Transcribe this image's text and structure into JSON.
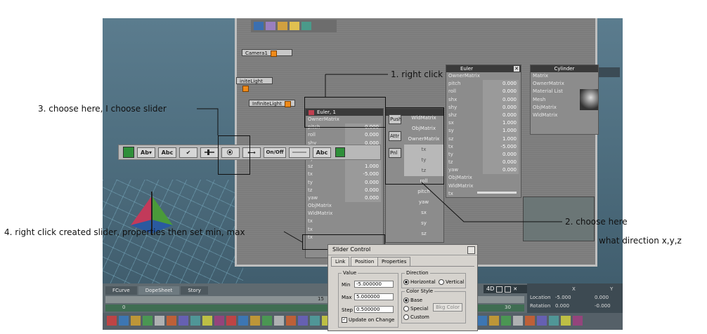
{
  "viewport": {
    "camera_chip": "Camera1",
    "light_chip_1": "initeLight",
    "light_chip_2": "InfiniteLight"
  },
  "euler_node_main": {
    "title": "Euler",
    "rows": [
      {
        "label": "OwnerMatrix",
        "value": ""
      },
      {
        "label": "pitch",
        "value": "0.000"
      },
      {
        "label": "roll",
        "value": "0.000"
      },
      {
        "label": "shx",
        "value": "0.000"
      },
      {
        "label": "shy",
        "value": "0.000"
      },
      {
        "label": "shz",
        "value": "0.000"
      },
      {
        "label": "sx",
        "value": "1.000"
      },
      {
        "label": "sy",
        "value": "1.000"
      },
      {
        "label": "sz",
        "value": "1.000"
      },
      {
        "label": "tx",
        "value": "-5.000"
      },
      {
        "label": "ty",
        "value": "0.000"
      },
      {
        "label": "tz",
        "value": "0.000"
      },
      {
        "label": "yaw",
        "value": "0.000"
      },
      {
        "label": "ObjMatrix",
        "value": ""
      },
      {
        "label": "WldMatrix",
        "value": ""
      },
      {
        "label": "tx",
        "value": ""
      }
    ]
  },
  "cylinder_node": {
    "title": "Cylinder",
    "rows": [
      "Matrix",
      "OwnerMatrix",
      "Material List",
      "Mesh",
      "ObjMatrix",
      "WldMatrix"
    ]
  },
  "euler_node_1": {
    "title": "Euler, 1",
    "rows": [
      {
        "label": "OwnerMatrix",
        "value": ""
      },
      {
        "label": "pitch",
        "value": "0.000"
      },
      {
        "label": "roll",
        "value": "0.000"
      },
      {
        "label": "shy",
        "value": "0.000"
      },
      {
        "label": "sx",
        "value": "1.000"
      },
      {
        "label": "sy",
        "value": "1.000"
      },
      {
        "label": "sz",
        "value": "1.000"
      },
      {
        "label": "tx",
        "value": "-5.000"
      },
      {
        "label": "ty",
        "value": "0.000"
      },
      {
        "label": "tz",
        "value": "0.000"
      },
      {
        "label": "yaw",
        "value": "0.000"
      },
      {
        "label": "ObjMatrix",
        "value": ""
      },
      {
        "label": "WldMatrix",
        "value": ""
      },
      {
        "label": "tx",
        "value": ""
      },
      {
        "label": "tx",
        "value": ""
      },
      {
        "label": "tx",
        "value": ""
      }
    ]
  },
  "matrix_node": {
    "buttons": [
      "Push",
      "Attr",
      "Pnl"
    ],
    "rows": [
      "WldMatrix",
      "ObjMatrix",
      "OwnerMatrix",
      "tx",
      "ty",
      "tz",
      "roll",
      "pitch",
      "yaw",
      "sx",
      "sy",
      "sz"
    ]
  },
  "toolbar": {
    "items": [
      "",
      "Ab▾",
      "Abc",
      "✔",
      "",
      "",
      "⟷",
      "On/Off",
      "",
      "Abc"
    ]
  },
  "annotations": {
    "step1": "1. right click",
    "step2": "2. choose here",
    "step3": "3. choose here, I choose slider",
    "step4": "4. right click created slider, properties then set min, max",
    "note": "what direction x,y,z"
  },
  "dialog": {
    "title": "Slider Control",
    "tabs": [
      "Link",
      "Position",
      "Properties"
    ],
    "value_group": "Value",
    "min_label": "Min",
    "min_value": "-5.000000",
    "max_label": "Max",
    "max_value": "5.000000",
    "step_label": "Step",
    "step_value": "0.500000",
    "update_label": "Update on Change",
    "direction_group": "Direction",
    "horizontal": "Horizontal",
    "vertical": "Vertical",
    "color_group": "Color Style",
    "base": "Base",
    "special": "Special",
    "custom": "Custom",
    "bkg_color": "Bkg Color"
  },
  "timeline": {
    "tabs": [
      "FCurve",
      "DopeSheet",
      "Story"
    ],
    "frame_left": "0",
    "frame_mid": "15",
    "frame_right": "30",
    "view_label": "4D"
  },
  "transform_panel": {
    "col_x": "X",
    "col_y": "Y",
    "location_label": "Location",
    "location_x": "-5.000",
    "location_y": "0.000",
    "rotation_label": "Rotation",
    "rotation_x": "0.000",
    "rotation_y": "-0.000"
  }
}
